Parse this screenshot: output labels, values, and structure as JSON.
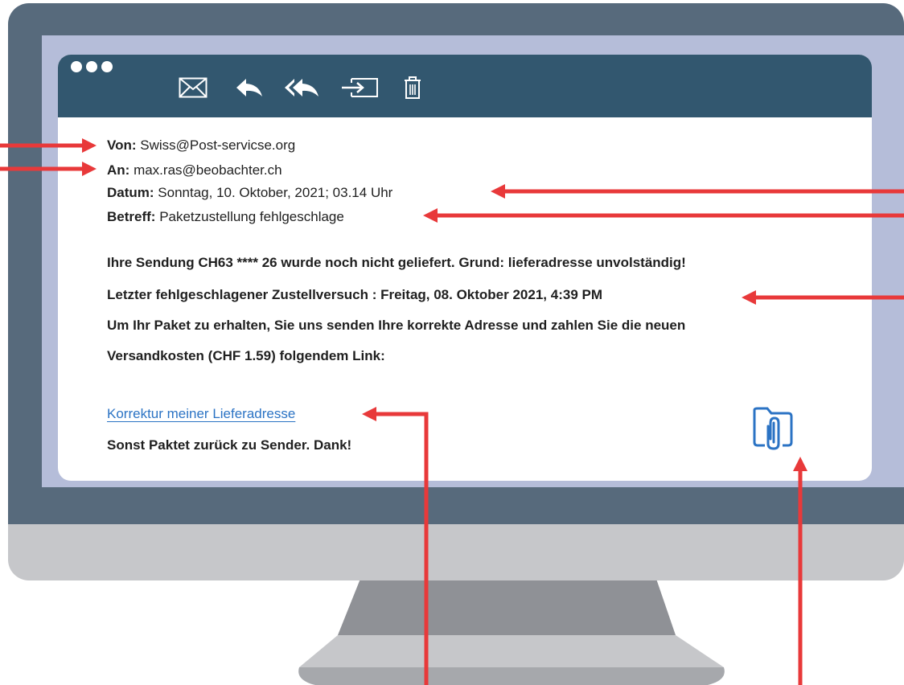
{
  "email": {
    "from_label": "Von:",
    "from_value": "Swiss@Post-servicse.org",
    "to_label": "An:",
    "to_value": "max.ras@beobachter.ch",
    "date_label": "Datum:",
    "date_value": "Sonntag, 10. Oktober, 2021; 03.14 Uhr",
    "subject_label": "Betreff:",
    "subject_value": "Paketzustellung fehlgeschlage",
    "body": [
      "Ihre Sendung CH63 **** 26 wurde noch nicht geliefert. Grund: lieferadresse unvolständig!",
      "Letzter fehlgeschlagener Zustellversuch : Freitag, 08. Oktober 2021, 4:39 PM",
      "Um Ihr Paket zu erhalten, Sie uns senden Ihre korrekte Adresse und zahlen Sie die neuen",
      "Versandkosten (CHF 1.59) folgendem Link:"
    ],
    "link_text": "Korrektur meiner Lieferadresse",
    "closing": "Sonst Paktet zurück zu Sender. Dank!"
  },
  "toolbar": {
    "icons": [
      "mail-icon",
      "reply-icon",
      "reply-all-icon",
      "move-to-folder-icon",
      "trash-icon"
    ]
  },
  "colors": {
    "toolbar": "#32576f",
    "bezel": "#576a7c",
    "screen_border": "#b5bdd9",
    "link": "#2b73c4",
    "arrow": "#e8393a",
    "attachment": "#2b73c4"
  }
}
